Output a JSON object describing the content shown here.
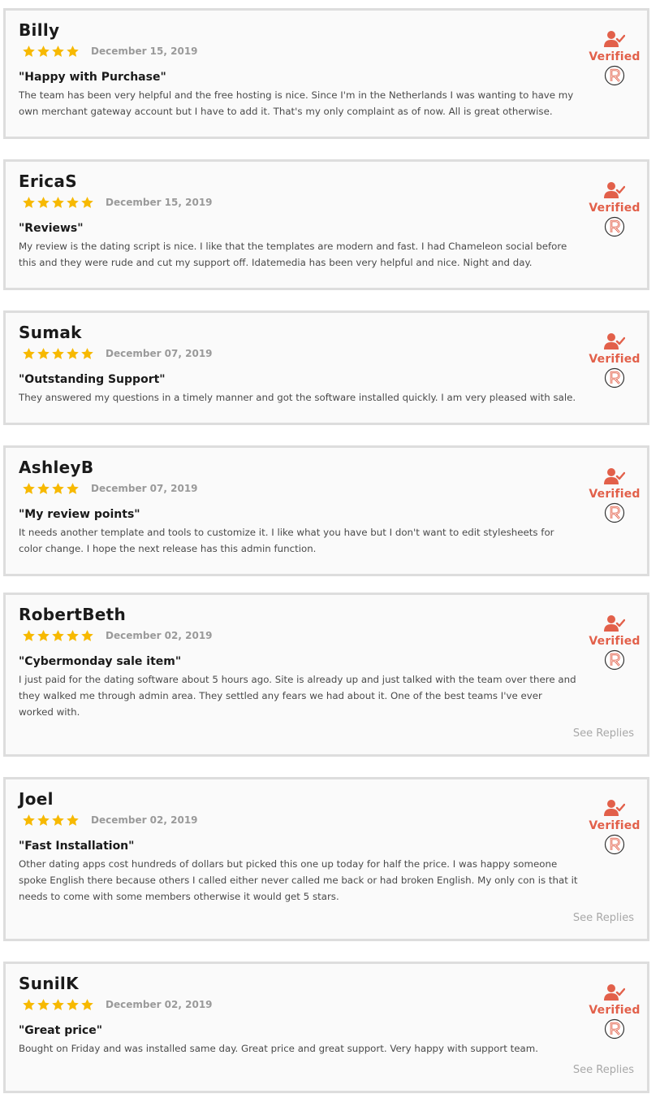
{
  "colors": {
    "accent": "#e2604a",
    "star": "#f7b900",
    "border": "#dddddd",
    "card_bg": "#fafafa"
  },
  "verified_label": "Verified",
  "see_replies_label": "See Replies",
  "icons": {
    "verified": "user-check-icon",
    "logo": "r-logo-icon",
    "rating": "star-icon"
  },
  "reviews": [
    {
      "name": "Billy",
      "stars": 4,
      "date": "December 15, 2019",
      "title": "\"Happy with Purchase\"",
      "text": "The team has been very helpful and the free hosting is nice. Since I'm in the Netherlands I was wanting to have my own merchant gateway account but I have to add it. That's my only complaint as of now. All is great otherwise.",
      "has_replies": false
    },
    {
      "name": "EricaS",
      "stars": 5,
      "date": "December 15, 2019",
      "title": "\"Reviews\"",
      "text": "My review is the dating script is nice. I like that the templates are modern and fast. I had Chameleon social before this and they were rude and cut my support off. Idatemedia has been very helpful and nice. Night and day.",
      "has_replies": false
    },
    {
      "name": "Sumak",
      "stars": 5,
      "date": "December 07, 2019",
      "title": "\"Outstanding Support\"",
      "text": "They answered my questions in a timely manner and got the software installed quickly. I am very pleased with sale.",
      "has_replies": false
    },
    {
      "name": "AshleyB",
      "stars": 4,
      "date": "December 07, 2019",
      "title": "\"My review points\"",
      "text": "It needs another template and tools to customize it. I like what you have but I don't want to edit stylesheets for color change. I hope the next release has this admin function.",
      "has_replies": false
    },
    {
      "name": "RobertBeth",
      "stars": 5,
      "date": "December 02, 2019",
      "title": "\"Cybermonday sale item\"",
      "text": "I just paid for the dating software about 5 hours ago. Site is already up and just talked with the team over there and they walked me through admin area. They settled any fears we had about it. One of the best teams I've ever worked with.",
      "has_replies": true
    },
    {
      "name": "Joel",
      "stars": 4,
      "date": "December 02, 2019",
      "title": "\"Fast Installation\"",
      "text": "Other dating apps cost hundreds of dollars but picked this one up today for half the price. I was happy someone spoke English there because others I called either never called me back or had broken English. My only con is that it needs to come with some members otherwise it would get 5 stars.",
      "has_replies": true
    },
    {
      "name": "SunilK",
      "stars": 5,
      "date": "December 02, 2019",
      "title": "\"Great price\"",
      "text": "Bought on Friday and was installed same day. Great price and great support. Very happy with support team.",
      "has_replies": true
    }
  ]
}
